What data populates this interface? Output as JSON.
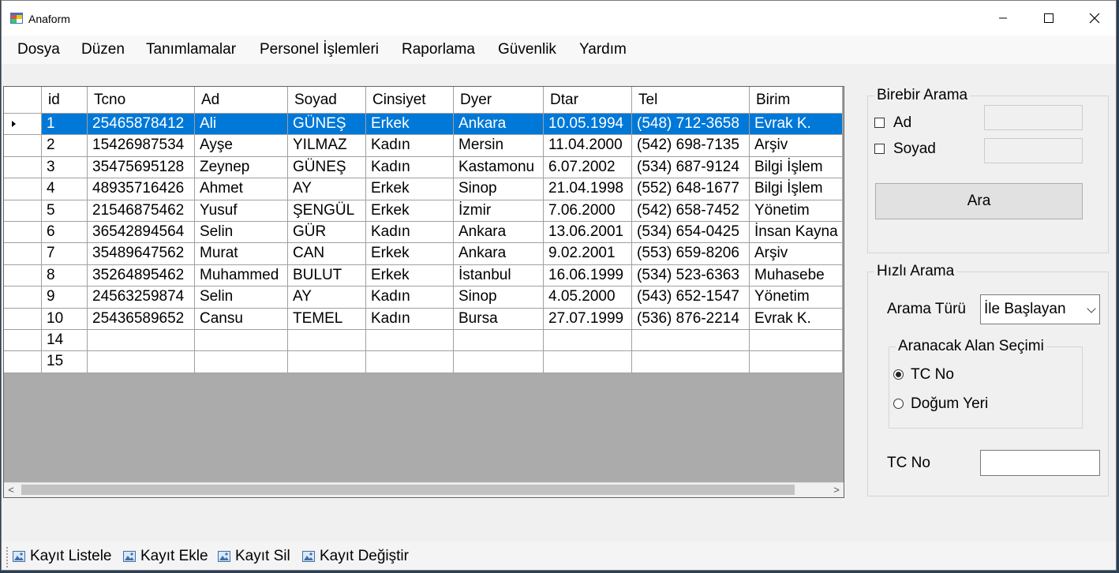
{
  "window": {
    "title": "Anaform"
  },
  "menu": [
    "Dosya",
    "Düzen",
    "Tanımlamalar",
    "Personel İşlemleri",
    "Raporlama",
    "Güvenlik",
    "Yardım"
  ],
  "grid": {
    "columns": [
      "id",
      "Tcno",
      "Ad",
      "Soyad",
      "Cinsiyet",
      "Dyer",
      "Dtar",
      "Tel",
      "Birim"
    ],
    "rows": [
      [
        "1",
        "25465878412",
        "Ali",
        "GÜNEŞ",
        "Erkek",
        "Ankara",
        "10.05.1994",
        "(548) 712-3658",
        "Evrak K."
      ],
      [
        "2",
        "15426987534",
        "Ayşe",
        "YILMAZ",
        "Kadın",
        "Mersin",
        "11.04.2000",
        "(542) 698-7135",
        "Arşiv"
      ],
      [
        "3",
        "35475695128",
        "Zeynep",
        "GÜNEŞ",
        "Kadın",
        "Kastamonu",
        "6.07.2002",
        "(534) 687-9124",
        "Bilgi İşlem"
      ],
      [
        "4",
        "48935716426",
        "Ahmet",
        "AY",
        "Erkek",
        "Sinop",
        "21.04.1998",
        "(552) 648-1677",
        "Bilgi İşlem"
      ],
      [
        "5",
        "21546875462",
        "Yusuf",
        "ŞENGÜL",
        "Erkek",
        "İzmir",
        "7.06.2000",
        "(542) 658-7452",
        "Yönetim"
      ],
      [
        "6",
        "36542894564",
        "Selin",
        "GÜR",
        "Kadın",
        "Ankara",
        "13.06.2001",
        "(534) 654-0425",
        "İnsan Kayna"
      ],
      [
        "7",
        "35489647562",
        "Murat",
        "CAN",
        "Erkek",
        "Ankara",
        "9.02.2001",
        "(553) 659-8206",
        "Arşiv"
      ],
      [
        "8",
        "35264895462",
        "Muhammed",
        "BULUT",
        "Erkek",
        "İstanbul",
        "16.06.1999",
        "(534) 523-6363",
        "Muhasebe"
      ],
      [
        "9",
        "24563259874",
        "Selin",
        "AY",
        "Kadın",
        "Sinop",
        "4.05.2000",
        "(543) 652-1547",
        "Yönetim"
      ],
      [
        "10",
        "25436589652",
        "Cansu",
        "TEMEL",
        "Kadın",
        "Bursa",
        "27.07.1999",
        "(536) 876-2214",
        "Evrak K."
      ],
      [
        "14",
        "",
        "",
        "",
        "",
        "",
        "",
        "",
        ""
      ],
      [
        "15",
        "",
        "",
        "",
        "",
        "",
        "",
        "",
        ""
      ]
    ],
    "selected_row": 0
  },
  "birebir": {
    "title": "Birebir Arama",
    "ad_label": "Ad",
    "soyad_label": "Soyad",
    "search_button": "Ara"
  },
  "hizli": {
    "title": "Hızlı Arama",
    "type_label": "Arama Türü",
    "type_value": "İle Başlayan",
    "field_group_title": "Aranacak Alan Seçimi",
    "option_tc": "TC No",
    "option_dogum": "Doğum Yeri",
    "tc_label": "TC No"
  },
  "toolbar": [
    "Kayıt Listele",
    "Kayıt Ekle",
    "Kayıt Sil",
    "Kayıt Değiştir"
  ]
}
